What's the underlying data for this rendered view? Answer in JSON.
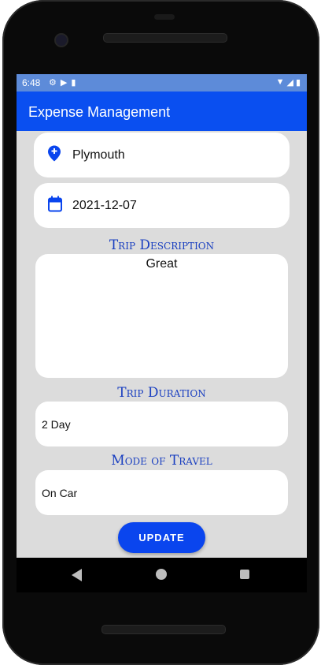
{
  "status_bar": {
    "time": "6:48"
  },
  "app_bar": {
    "title": "Expense Management"
  },
  "form": {
    "destination": {
      "value": "Plymouth",
      "icon": "map-pin-plus-icon"
    },
    "date": {
      "value": "2021-12-07",
      "icon": "calendar-icon"
    },
    "trip_description": {
      "label": "Trip Description",
      "value": "Great"
    },
    "trip_duration": {
      "label": "Trip Duration",
      "value": "2 Day"
    },
    "mode_of_travel": {
      "label": "Mode of Travel",
      "value": "On Car"
    },
    "update_label": "UPDATE"
  },
  "colors": {
    "app_bar": "#0a4ff0",
    "status_bar": "#5d8bd9",
    "label": "#1a3fc0",
    "button": "#0a45ee",
    "screen_bg": "#dcdcdc"
  }
}
